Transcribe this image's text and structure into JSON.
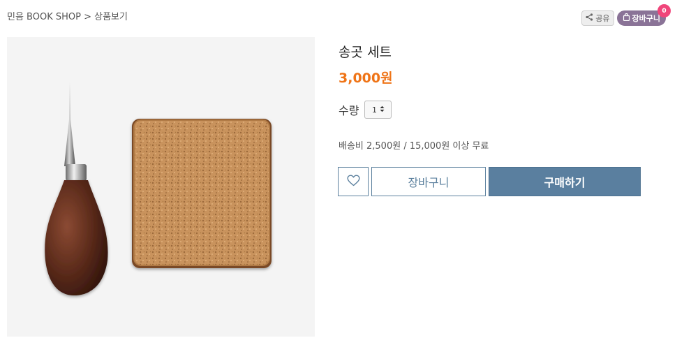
{
  "breadcrumb": "민음 BOOK SHOP > 상품보기",
  "top_actions": {
    "share_label": "공유",
    "cart_label": "장바구니",
    "cart_count": "0"
  },
  "product": {
    "title": "송곳 세트",
    "price": "3,000원",
    "quantity_label": "수량",
    "quantity_value": "1",
    "shipping": "배송비 2,500원 / 15,000원 이상 무료",
    "image_icons": [
      "awl-icon",
      "cork-pad-icon"
    ]
  },
  "buttons": {
    "wish_icon": "heart-icon",
    "cart_label": "장바구니",
    "buy_label": "구매하기"
  },
  "colors": {
    "price": "#ef7417",
    "accent": "#5a7f9f",
    "cart_badge": "#f0457a",
    "cart_top_bg": "#8a7397"
  }
}
